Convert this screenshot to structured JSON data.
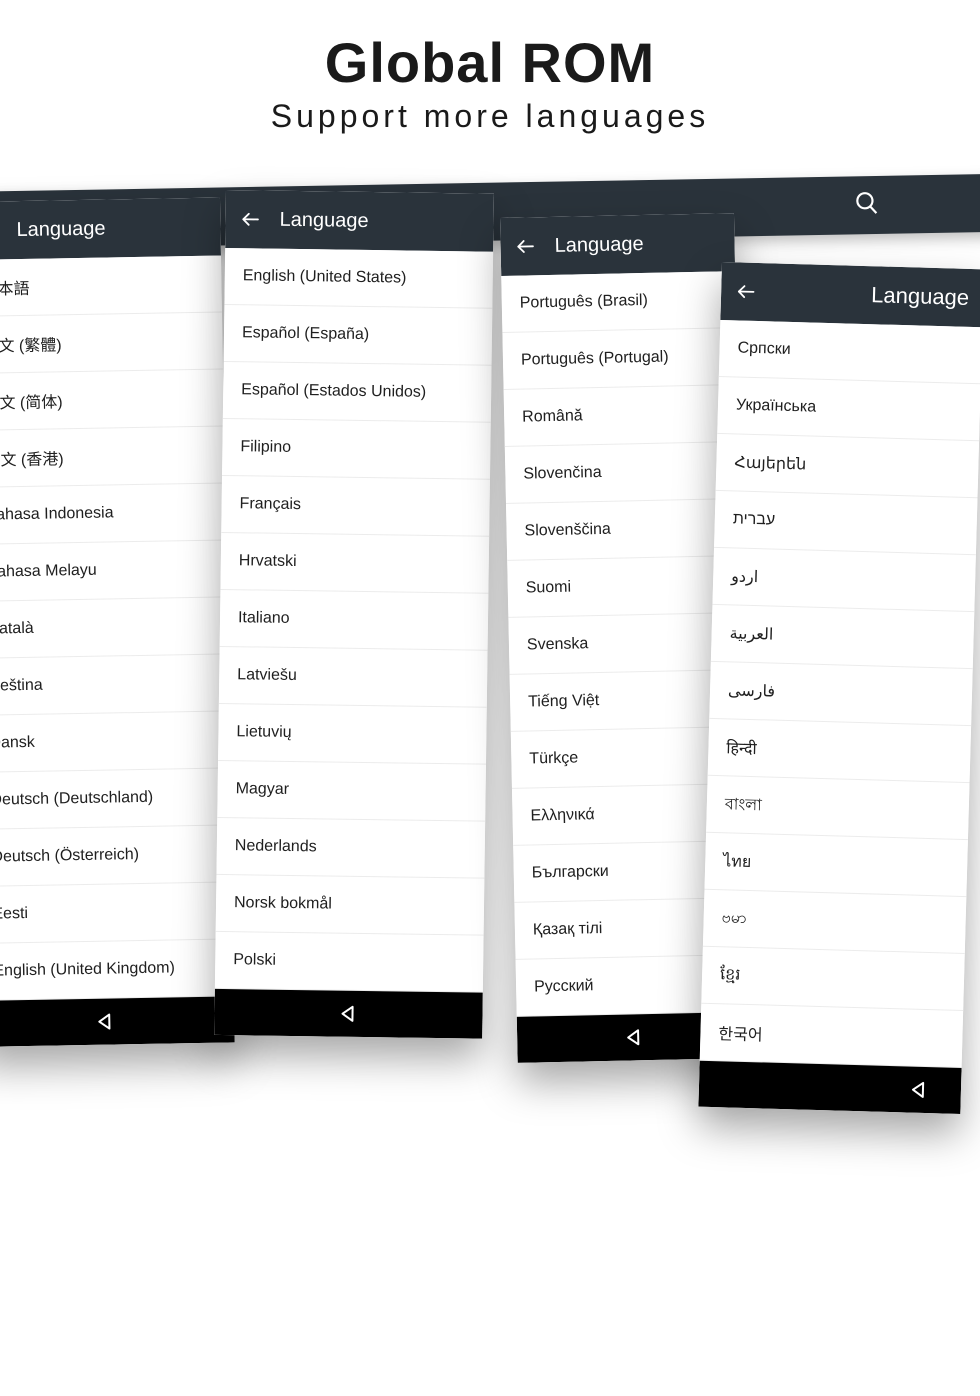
{
  "heading": {
    "line1": "Global ROM",
    "line2": "Support more languages"
  },
  "header_label": "Language",
  "screens": [
    {
      "items": [
        "日本語",
        "中文 (繁體)",
        "中文 (简体)",
        "中文 (香港)",
        "Bahasa Indonesia",
        "Bahasa Melayu",
        "Català",
        "Čeština",
        "Dansk",
        "Deutsch (Deutschland)",
        "Deutsch (Österreich)",
        "Eesti",
        "English (United Kingdom)"
      ]
    },
    {
      "items": [
        "English (United States)",
        "Español (España)",
        "Español (Estados Unidos)",
        "Filipino",
        "Français",
        "Hrvatski",
        "Italiano",
        "Latviešu",
        "Lietuvių",
        "Magyar",
        "Nederlands",
        "Norsk bokmål",
        "Polski"
      ]
    },
    {
      "items": [
        "Português (Brasil)",
        "Português (Portugal)",
        "Română",
        "Slovenčina",
        "Slovenščina",
        "Suomi",
        "Svenska",
        "Tiếng Việt",
        "Türkçe",
        "Ελληνικά",
        "Български",
        "Қазақ тілі",
        "Русский"
      ]
    },
    {
      "items": [
        "Српски",
        "Українська",
        "Հայերեն",
        "עברית",
        "اردو",
        "العربية",
        "فارسی",
        "हिन्दी",
        "বাংলা",
        "ไทย",
        "ဗမာ",
        "ខ្មែរ",
        "한국어"
      ]
    }
  ]
}
